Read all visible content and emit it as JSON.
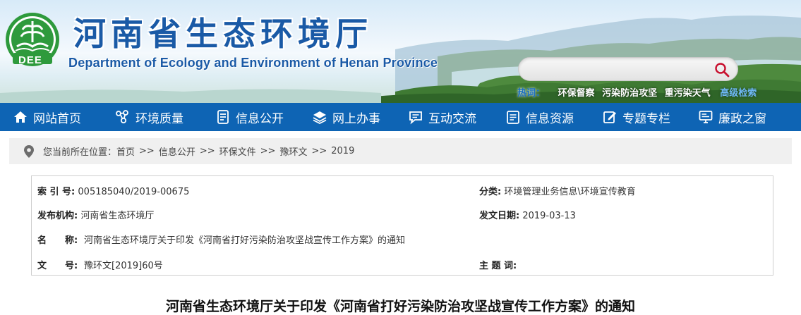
{
  "header": {
    "title": "河南省生态环境厅",
    "subtitle": "Department of Ecology and Environment of Henan Province",
    "logo_text": "DEE",
    "search": {
      "placeholder": "",
      "button_icon": "search-icon"
    },
    "hot": {
      "label": "热词：",
      "links": [
        "环保督察",
        "污染防治攻坚",
        "重污染天气"
      ],
      "advanced": "高级检索"
    }
  },
  "nav": {
    "items": [
      {
        "label": "网站首页",
        "icon": "home-icon"
      },
      {
        "label": "环境质量",
        "icon": "molecule-icon"
      },
      {
        "label": "信息公开",
        "icon": "document-icon"
      },
      {
        "label": "网上办事",
        "icon": "layers-icon"
      },
      {
        "label": "互动交流",
        "icon": "chat-icon"
      },
      {
        "label": "信息资源",
        "icon": "folder-icon"
      },
      {
        "label": "专题专栏",
        "icon": "edit-icon"
      },
      {
        "label": "廉政之窗",
        "icon": "monitor-icon"
      }
    ]
  },
  "breadcrumb": {
    "prefix": "您当前所在位置：",
    "items": [
      "首页",
      "信息公开",
      "环保文件",
      "豫环文",
      "2019"
    ],
    "separator": ">>"
  },
  "meta": {
    "index_label": "索 引 号:",
    "index_value": "005185040/2019-00675",
    "category_label": "分类:",
    "category_value": "环境管理业务信息\\环境宣传教育",
    "publisher_label": "发布机构:",
    "publisher_value": "河南省生态环境厅",
    "date_label": "发文日期:",
    "date_value": "2019-03-13",
    "name_label_1": "名",
    "name_label_2": "称:",
    "name_value": "河南省生态环境厅关于印发《河南省打好污染防治攻坚战宣传工作方案》的通知",
    "docno_label_1": "文",
    "docno_label_2": "号:",
    "docno_value": "豫环文[2019]60号",
    "keywords_label": "主 题 词:",
    "keywords_value": ""
  },
  "article": {
    "title": "河南省生态环境厅关于印发《河南省打好污染防治攻坚战宣传工作方案》的通知"
  },
  "colors": {
    "brand_blue": "#1a5aa6",
    "nav_bg": "#0e64b4",
    "logo_green": "#2e9a3c",
    "crumb_bg": "#f0f0f0",
    "search_icon": "#c8102e"
  }
}
